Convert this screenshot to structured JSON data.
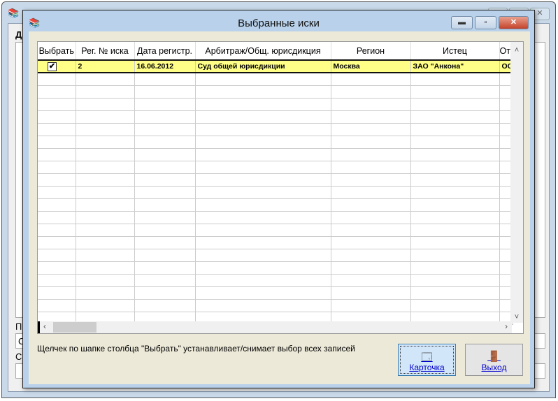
{
  "parent": {
    "labels": [
      "Д",
      "П",
      "С"
    ],
    "field_value": "С"
  },
  "dialog": {
    "title": "Выбранные иски",
    "columns": [
      "Выбрать",
      "Рег. № иска",
      "Дата регистр.",
      "Арбитраж/Общ. юрисдикция",
      "Регион",
      "Истец",
      "От"
    ],
    "rows": [
      {
        "checked": true,
        "reg_no": "2",
        "date": "16.06.2012",
        "jurisdiction": "Суд общей юрисдикции",
        "region": "Москва",
        "plaintiff": "ЗАО \"Анкона\"",
        "defendant": "ОС"
      }
    ],
    "note": "Щелчек по шапке столбца \"Выбрать\" устанавливает/снимает выбор всех записей",
    "buttons": {
      "card": "Карточка",
      "exit": "Выход"
    }
  },
  "colors": {
    "selected_row": "#ffff88",
    "content_bg": "#ece9d8"
  }
}
